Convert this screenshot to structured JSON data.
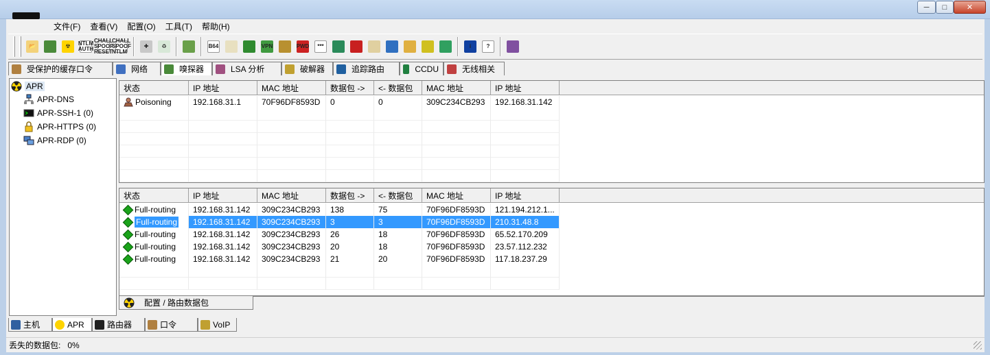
{
  "window": {
    "buttons": {
      "minimize": "─",
      "maximize": "□",
      "close": "✕"
    }
  },
  "menu": [
    "文件(F)",
    "查看(V)",
    "配置(O)",
    "工具(T)",
    "帮助(H)"
  ],
  "toolbar": {
    "buttons": [
      {
        "name": "open-icon",
        "glyph": "📂",
        "color": "#f3d27a"
      },
      {
        "name": "sniffer-start-icon",
        "glyph": "",
        "color": "#4a8a3a"
      },
      {
        "name": "apr-start-icon",
        "glyph": "☢",
        "color": "#ffd400"
      },
      {
        "name": "ntlm-auth-icon",
        "glyph": "NTLM AUTH",
        "color": "#ffffff"
      },
      {
        "name": "chall-spoof-reset-icon",
        "glyph": "CHALL SPOOF RESET",
        "color": "#ffffff"
      },
      {
        "name": "chall-spoof-ntlm-icon",
        "glyph": "CHALL SPOOF NTLM",
        "color": "#ffffff"
      },
      {
        "name": "add-icon",
        "glyph": "✚",
        "color": "#c8c8c8"
      },
      {
        "name": "remove-icon",
        "glyph": "♻",
        "color": "#d8e8d8"
      },
      {
        "name": "decoder-icon",
        "glyph": "",
        "color": "#6aa04a"
      },
      {
        "name": "base64-icon",
        "glyph": "B64",
        "color": "#ffffff"
      },
      {
        "name": "hash-calculator-icon",
        "glyph": "",
        "color": "#e8e0c0"
      },
      {
        "name": "network-scan-icon",
        "glyph": "",
        "color": "#2f8a2f"
      },
      {
        "name": "vpn-icon",
        "glyph": "VPN",
        "color": "#3f9a3f"
      },
      {
        "name": "key-icon",
        "glyph": "",
        "color": "#b89030"
      },
      {
        "name": "pwd-decoder-icon",
        "glyph": "PWD",
        "color": "#cc2222"
      },
      {
        "name": "password-mask-icon",
        "glyph": "***",
        "color": "#ffffff"
      },
      {
        "name": "box-icon",
        "glyph": "",
        "color": "#2a8a5a"
      },
      {
        "name": "rdp-icon",
        "glyph": "",
        "color": "#c82020"
      },
      {
        "name": "lock-icon",
        "glyph": "",
        "color": "#e0d0a0"
      },
      {
        "name": "users-icon",
        "glyph": "",
        "color": "#3070c0"
      },
      {
        "name": "certificate-icon",
        "glyph": "",
        "color": "#e0b040"
      },
      {
        "name": "wallet-icon",
        "glyph": "",
        "color": "#d0c020"
      },
      {
        "name": "wireless-icon",
        "glyph": "",
        "color": "#30a060"
      },
      {
        "name": "info-icon",
        "glyph": "i",
        "color": "#1040a0"
      },
      {
        "name": "help-icon",
        "glyph": "?",
        "color": "#ffffff"
      },
      {
        "name": "exit-icon",
        "glyph": "",
        "color": "#8050a0"
      }
    ]
  },
  "tabs": [
    {
      "label": "受保护的缓存口令",
      "icon": "protected-storage-icon",
      "color": "#b08040"
    },
    {
      "label": "网络",
      "icon": "network-icon",
      "color": "#4070c0"
    },
    {
      "label": "嗅探器",
      "icon": "sniffer-icon",
      "color": "#4a8a3a"
    },
    {
      "label": "LSA 分析",
      "icon": "lsa-icon",
      "color": "#a05080"
    },
    {
      "label": "破解器",
      "icon": "cracker-icon",
      "color": "#c0a030"
    },
    {
      "label": "追踪路由",
      "icon": "traceroute-icon",
      "color": "#2060a0"
    },
    {
      "label": "CCDU",
      "icon": "ccdu-icon",
      "color": "#208040"
    },
    {
      "label": "无线相关",
      "icon": "wireless-icon",
      "color": "#c04040"
    }
  ],
  "tree": {
    "root": "APR",
    "children": [
      "APR-DNS",
      "APR-SSH-1 (0)",
      "APR-HTTPS (0)",
      "APR-RDP (0)"
    ]
  },
  "columns": [
    "状态",
    "IP 地址",
    "MAC 地址",
    "数据包 ->",
    "<- 数据包",
    "MAC 地址",
    "IP 地址"
  ],
  "top_rows": [
    [
      "Poisoning",
      "192.168.31.1",
      "70F96DF8593D",
      "0",
      "0",
      "309C234CB293",
      "192.168.31.142"
    ]
  ],
  "bottom_rows": [
    [
      "Full-routing",
      "192.168.31.142",
      "309C234CB293",
      "138",
      "75",
      "70F96DF8593D",
      "121.194.212.1..."
    ],
    [
      "Full-routing",
      "192.168.31.142",
      "309C234CB293",
      "3",
      "3",
      "70F96DF8593D",
      "210.31.48.8"
    ],
    [
      "Full-routing",
      "192.168.31.142",
      "309C234CB293",
      "26",
      "18",
      "70F96DF8593D",
      "65.52.170.209"
    ],
    [
      "Full-routing",
      "192.168.31.142",
      "309C234CB293",
      "20",
      "18",
      "70F96DF8593D",
      "23.57.112.232"
    ],
    [
      "Full-routing",
      "192.168.31.142",
      "309C234CB293",
      "21",
      "20",
      "70F96DF8593D",
      "117.18.237.29"
    ]
  ],
  "selected_bottom_row": 1,
  "inner_tab": "配置 / 路由数据包",
  "bottom_tabs": [
    {
      "label": "主机",
      "icon": "host-icon",
      "active": false
    },
    {
      "label": "APR",
      "icon": "apr-icon",
      "active": true
    },
    {
      "label": "路由器",
      "icon": "router-icon",
      "active": false
    },
    {
      "label": "口令",
      "icon": "password-icon",
      "active": false
    },
    {
      "label": "VoIP",
      "icon": "voip-icon",
      "active": false
    }
  ],
  "status": {
    "label": "丢失的数据包:",
    "value": "0%"
  }
}
